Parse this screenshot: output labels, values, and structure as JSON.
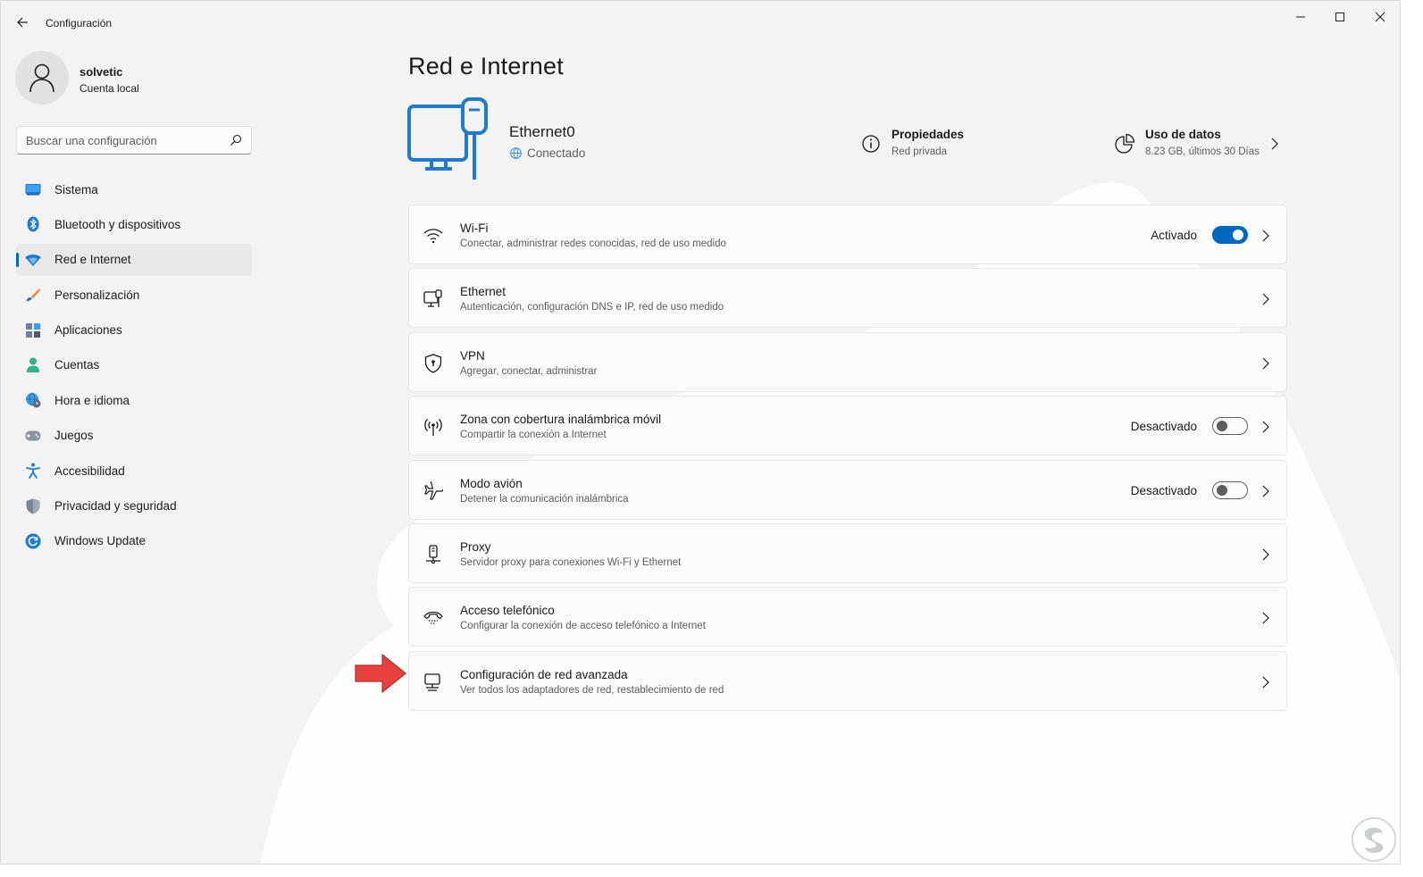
{
  "window": {
    "title": "Configuración"
  },
  "user": {
    "name": "solvetic",
    "account": "Cuenta local"
  },
  "search": {
    "placeholder": "Buscar una configuración"
  },
  "nav": [
    {
      "label": "Sistema",
      "icon": "monitor-icon"
    },
    {
      "label": "Bluetooth y dispositivos",
      "icon": "bluetooth-icon"
    },
    {
      "label": "Red e Internet",
      "icon": "wifi-diamond-icon",
      "active": true
    },
    {
      "label": "Personalización",
      "icon": "brush-icon"
    },
    {
      "label": "Aplicaciones",
      "icon": "apps-icon"
    },
    {
      "label": "Cuentas",
      "icon": "person-icon"
    },
    {
      "label": "Hora e idioma",
      "icon": "globe-clock-icon"
    },
    {
      "label": "Juegos",
      "icon": "gamepad-icon"
    },
    {
      "label": "Accesibilidad",
      "icon": "accessibility-icon"
    },
    {
      "label": "Privacidad y seguridad",
      "icon": "shield-icon"
    },
    {
      "label": "Windows Update",
      "icon": "update-icon"
    }
  ],
  "page": {
    "title": "Red e Internet"
  },
  "hero": {
    "name": "Ethernet0",
    "status": "Conectado",
    "properties": {
      "title": "Propiedades",
      "subtitle": "Red privada"
    },
    "data_usage": {
      "title": "Uso de datos",
      "subtitle": "8.23 GB, últimos 30 Días"
    }
  },
  "cards": [
    {
      "title": "Wi-Fi",
      "subtitle": "Conectar, administrar redes conocidas, red de uso medido",
      "state": "Activado",
      "toggle": "on",
      "icon": "wifi-icon"
    },
    {
      "title": "Ethernet",
      "subtitle": "Autenticación, configuración DNS e IP, red de uso medido",
      "state": "",
      "toggle": "none",
      "icon": "ethernet-icon"
    },
    {
      "title": "VPN",
      "subtitle": "Agregar, conectar, administrar",
      "state": "",
      "toggle": "none",
      "icon": "vpn-shield-icon"
    },
    {
      "title": "Zona con cobertura inalámbrica móvil",
      "subtitle": "Compartir la conexión a Internet",
      "state": "Desactivado",
      "toggle": "off",
      "icon": "hotspot-icon"
    },
    {
      "title": "Modo avión",
      "subtitle": "Detener la comunicación inalámbrica",
      "state": "Desactivado",
      "toggle": "off",
      "icon": "airplane-icon"
    },
    {
      "title": "Proxy",
      "subtitle": "Servidor proxy para conexiones Wi-Fi y Ethernet",
      "state": "",
      "toggle": "none",
      "icon": "proxy-icon"
    },
    {
      "title": "Acceso telefónico",
      "subtitle": "Configurar la conexión de acceso telefónico a Internet",
      "state": "",
      "toggle": "none",
      "icon": "dialup-icon"
    },
    {
      "title": "Configuración de red avanzada",
      "subtitle": "Ver todos los adaptadores de red, restablecimiento de red",
      "state": "",
      "toggle": "none",
      "icon": "advanced-network-icon"
    }
  ],
  "colors": {
    "accent": "#0067c0",
    "annotation_arrow": "#e8403f",
    "background": "#f3f3f3",
    "card": "#fbfbfb"
  }
}
